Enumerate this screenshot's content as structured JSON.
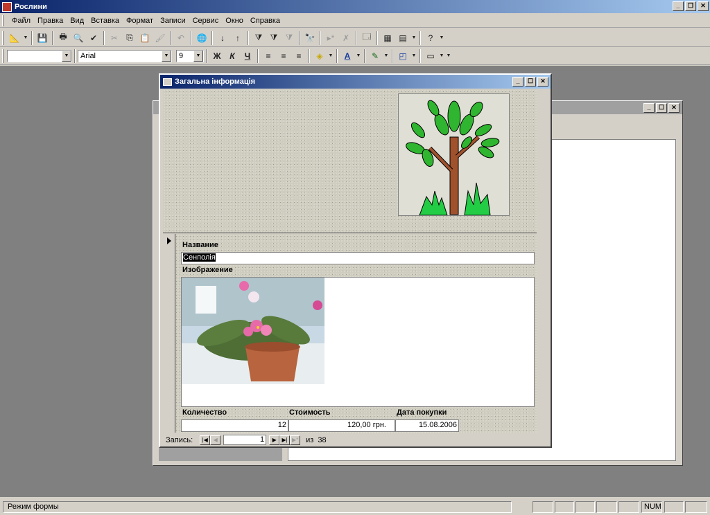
{
  "app": {
    "title": "Рослини"
  },
  "menu": [
    "Файл",
    "Правка",
    "Вид",
    "Вставка",
    "Формат",
    "Записи",
    "Сервис",
    "Окно",
    "Справка"
  ],
  "format_toolbar": {
    "object_value": "",
    "font": "Arial",
    "size": "9",
    "bold": "Ж",
    "italic": "К",
    "underline": "Ч"
  },
  "form": {
    "title": "Загальна інформація",
    "name_label": "Название",
    "name_value": "Сенполія",
    "image_label": "Изображение",
    "qty_label": "Количество",
    "qty_value": "12",
    "cost_label": "Стоимость",
    "cost_value": "120,00 грн.",
    "date_label": "Дата покупки",
    "date_value": "15.08.2006"
  },
  "navigation": {
    "label": "Запись:",
    "current": "1",
    "of_label": "из",
    "total": "38"
  },
  "status": {
    "mode": "Режим формы",
    "num": "NUM"
  },
  "colors": {
    "title_start": "#0a246a",
    "title_end": "#a6caf0",
    "workspace": "#808080",
    "face": "#d4d0c8"
  }
}
